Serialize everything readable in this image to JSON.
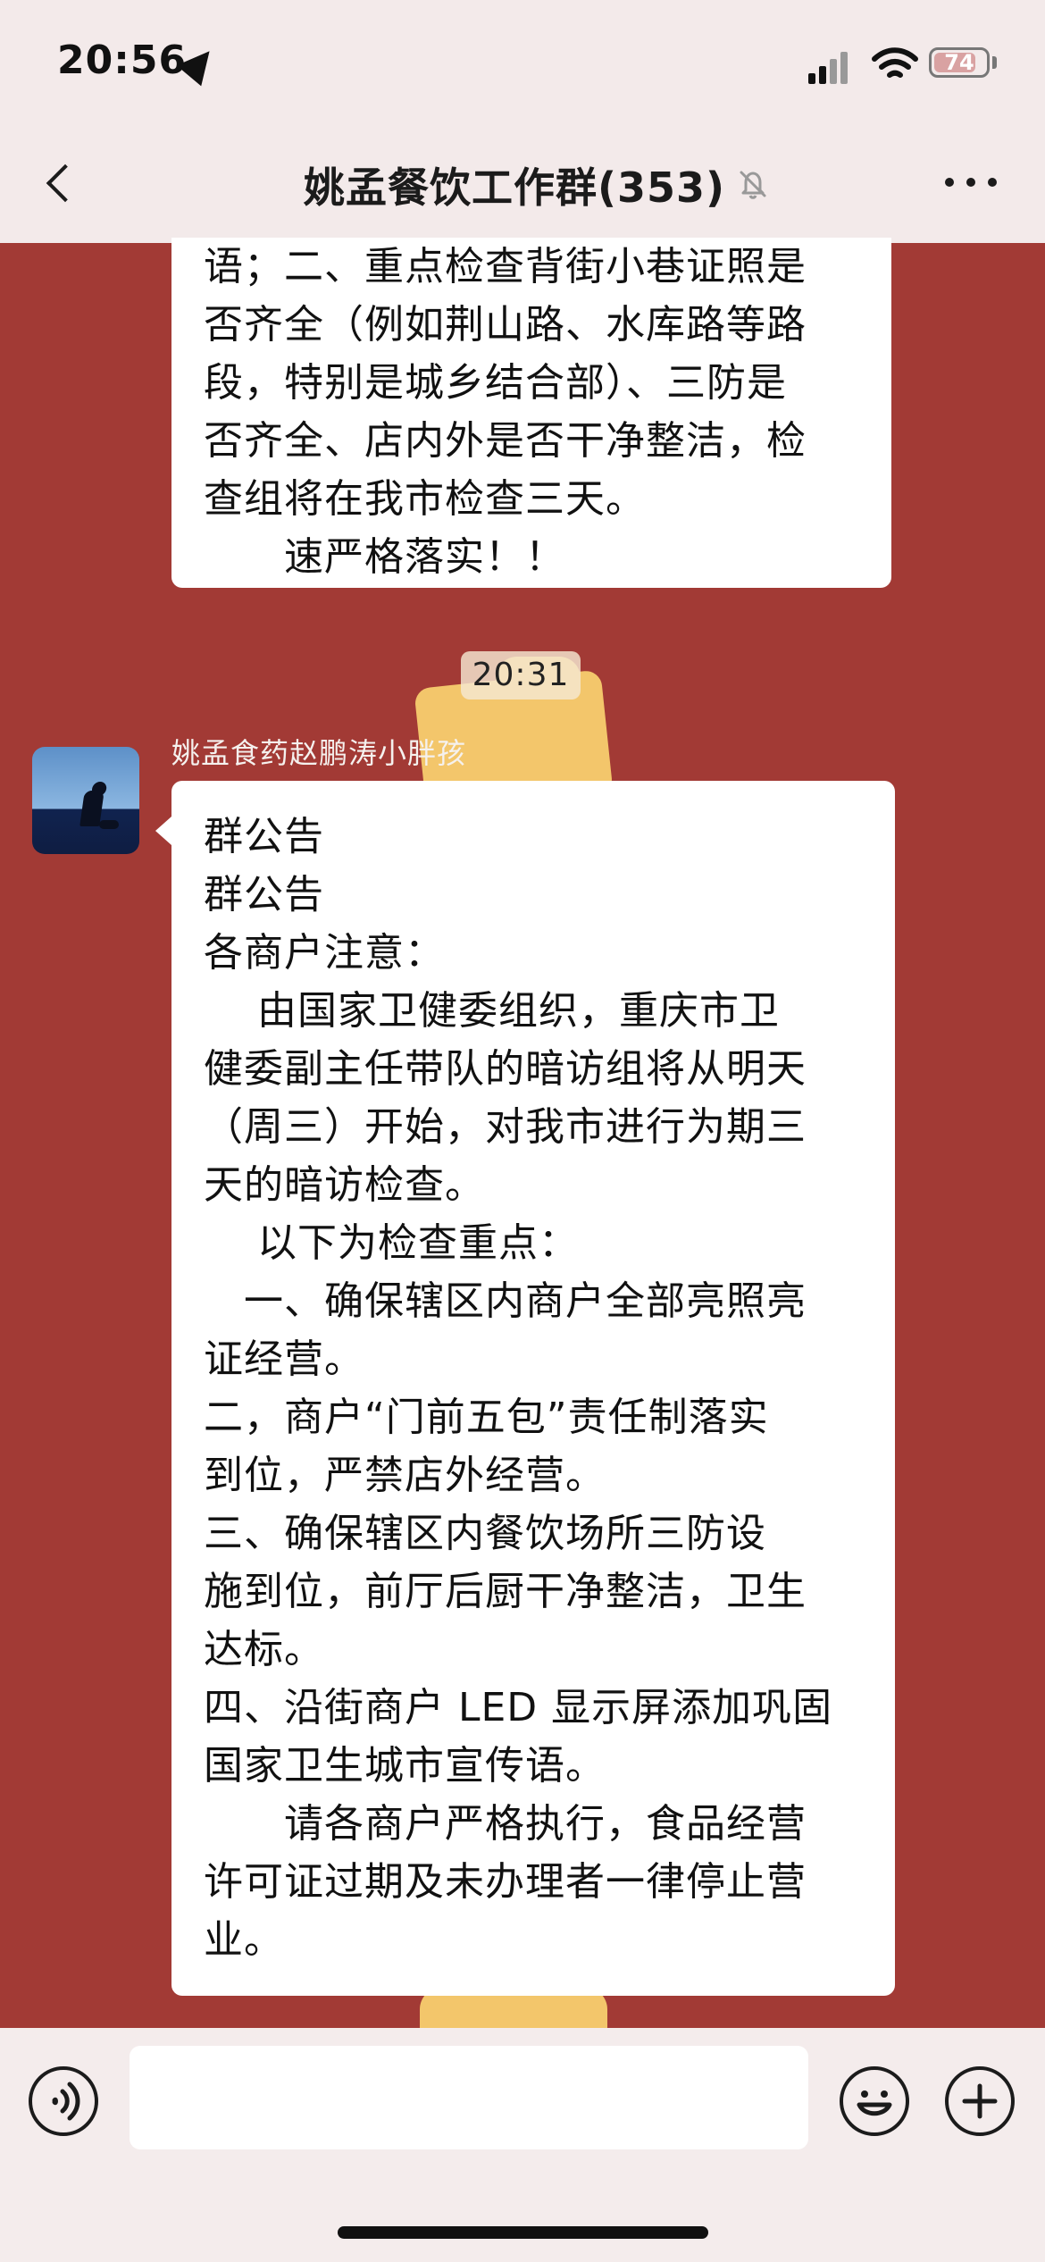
{
  "status_bar": {
    "time": "20:56",
    "battery": "74"
  },
  "header": {
    "title": "姚孟餐饮工作群(353)"
  },
  "messages": {
    "previous": {
      "text": "语；二、重点检查背街小巷证照是\n否齐全（例如荆山路、水库路等路\n段，特别是城乡结合部）、三防是\n否齐全、店内外是否干净整洁，检\n查组将在我市检查三天。\n　　速严格落实！！"
    },
    "timestamp": "20:31",
    "announcement": {
      "sender": "姚孟食药赵鹏涛小胖孩",
      "text": "群公告\n群公告\n各商户注意：\n　 由国家卫健委组织，重庆市卫\n健委副主任带队的暗访组将从明天\n（周三）开始，对我市进行为期三\n天的暗访检查。\n　 以下为检查重点：\n　一、确保辖区内商户全部亮照亮\n证经营。\n 二，商户“门前五包”责任制落实\n到位，严禁店外经营。\n 三、确保辖区内餐饮场所三防设\n施到位，前厅后厨干净整洁，卫生\n达标。\n四、沿街商户 LED 显示屏添加巩固\n国家卫生城市宣传语。\n　　请各商户严格执行，食品经营\n许可证过期及未办理者一律停止营\n业。"
    }
  },
  "icons": {
    "back": "chevron-left-icon",
    "mute": "muted-bell-icon",
    "more": "more-icon",
    "voice": "voice-icon",
    "emoji": "emoji-icon",
    "add": "plus-icon"
  },
  "colors": {
    "chat_background": "#a23a35",
    "bubble_background": "#ffffff",
    "top_bar_background": "#f3eaea",
    "accent_yellow": "#f3c66b"
  }
}
